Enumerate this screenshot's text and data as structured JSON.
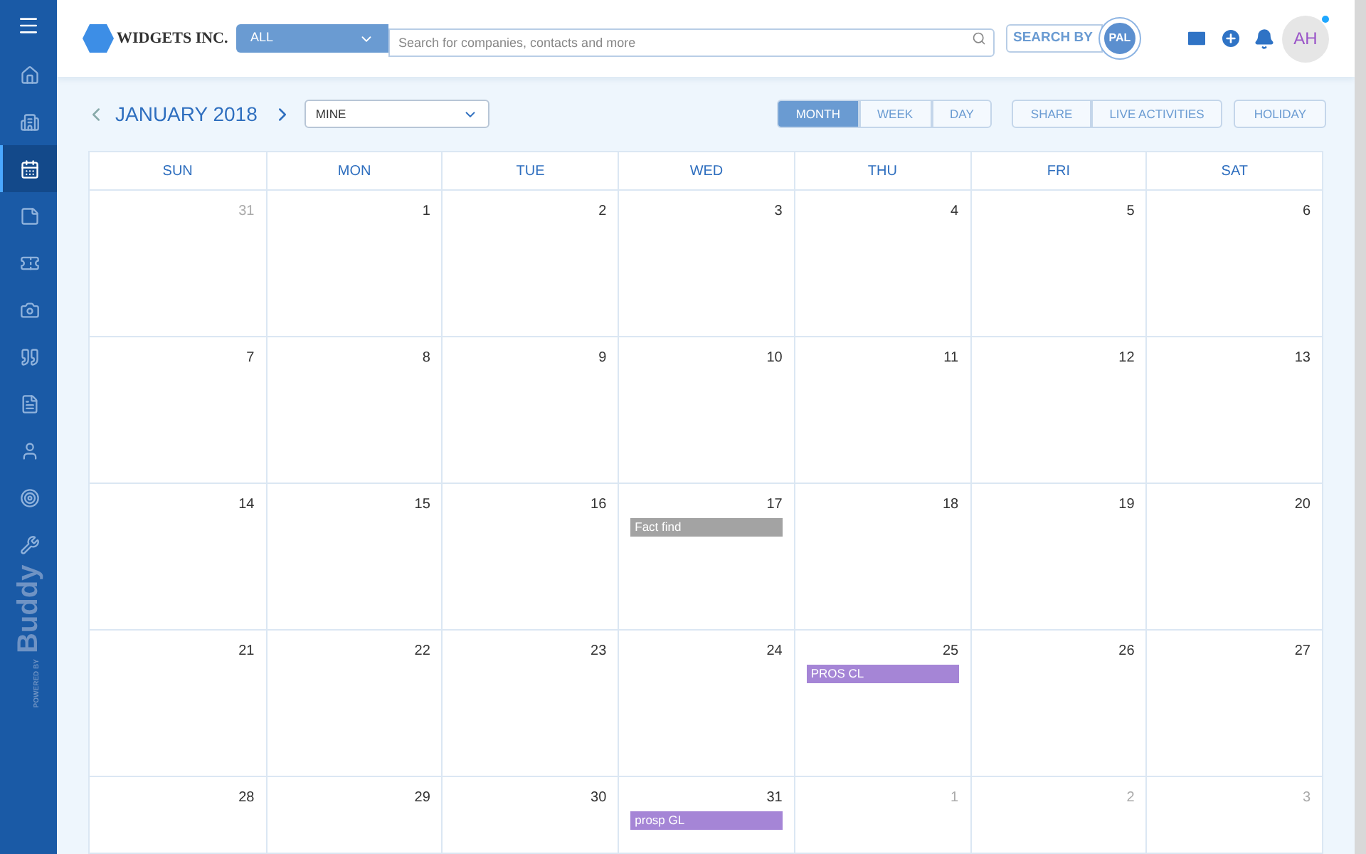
{
  "sidebar": {
    "items": [
      {
        "selected": false
      },
      {
        "selected": false
      },
      {
        "selected": true
      },
      {
        "selected": false
      },
      {
        "selected": false
      },
      {
        "selected": false
      },
      {
        "selected": false
      },
      {
        "selected": false
      },
      {
        "selected": false
      },
      {
        "selected": false
      },
      {
        "selected": false
      }
    ],
    "powered_by": "POWERED BY",
    "brand": "Buddy"
  },
  "header": {
    "logo": "WIDGETS INC.",
    "scope": "ALL",
    "search": {
      "placeholder": "Search for companies, contacts and more"
    },
    "search_by": "SEARCH BY",
    "search_by_badge": "PAL",
    "avatar": "AH"
  },
  "toolbar": {
    "month_title": "JANUARY 2018",
    "filter": "MINE",
    "views": [
      {
        "label": "MONTH",
        "selected": true
      },
      {
        "label": "WEEK",
        "selected": false
      },
      {
        "label": "DAY",
        "selected": false
      }
    ],
    "actions": [
      "SHARE",
      "LIVE ACTIVITIES"
    ],
    "holiday": "HOLIDAY"
  },
  "calendar": {
    "weekdays": [
      "SUN",
      "MON",
      "TUE",
      "WED",
      "THU",
      "FRI",
      "SAT"
    ],
    "weeks": [
      [
        {
          "day": "31",
          "other_month": true
        },
        {
          "day": "1",
          "other_month": false
        },
        {
          "day": "2",
          "other_month": false
        },
        {
          "day": "3",
          "other_month": false
        },
        {
          "day": "4",
          "other_month": false
        },
        {
          "day": "5",
          "other_month": false
        },
        {
          "day": "6",
          "other_month": false
        }
      ],
      [
        {
          "day": "7",
          "other_month": false
        },
        {
          "day": "8",
          "other_month": false
        },
        {
          "day": "9",
          "other_month": false
        },
        {
          "day": "10",
          "other_month": false
        },
        {
          "day": "11",
          "other_month": false
        },
        {
          "day": "12",
          "other_month": false
        },
        {
          "day": "13",
          "other_month": false
        }
      ],
      [
        {
          "day": "14",
          "other_month": false
        },
        {
          "day": "15",
          "other_month": false
        },
        {
          "day": "16",
          "other_month": false
        },
        {
          "day": "17",
          "other_month": false,
          "events": [
            {
              "title": "Fact find",
              "color": "#a3a3a3"
            }
          ]
        },
        {
          "day": "18",
          "other_month": false
        },
        {
          "day": "19",
          "other_month": false
        },
        {
          "day": "20",
          "other_month": false
        }
      ],
      [
        {
          "day": "21",
          "other_month": false
        },
        {
          "day": "22",
          "other_month": false
        },
        {
          "day": "23",
          "other_month": false
        },
        {
          "day": "24",
          "other_month": false
        },
        {
          "day": "25",
          "other_month": false,
          "events": [
            {
              "title": "PROS CL",
              "color": "#a585d6"
            }
          ]
        },
        {
          "day": "26",
          "other_month": false
        },
        {
          "day": "27",
          "other_month": false
        }
      ],
      [
        {
          "day": "28",
          "other_month": false
        },
        {
          "day": "29",
          "other_month": false
        },
        {
          "day": "30",
          "other_month": false
        },
        {
          "day": "31",
          "other_month": false,
          "events": [
            {
              "title": "prosp GL",
              "color": "#a585d6"
            }
          ]
        },
        {
          "day": "1",
          "other_month": true
        },
        {
          "day": "2",
          "other_month": true
        },
        {
          "day": "3",
          "other_month": true
        }
      ]
    ]
  }
}
